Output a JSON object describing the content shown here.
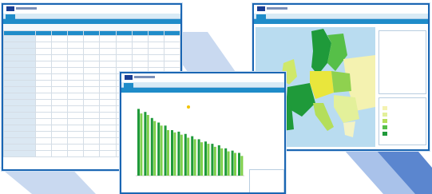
{
  "colors": {
    "frame": "#1a66b3",
    "accent": "#1f8cc9",
    "stripe_light": "#c9d9f0",
    "stripe_dark": "#5b86cf",
    "bar_dark": "#1f9a3a",
    "bar_light": "#7fd04b",
    "map_sea": "#b9dcf0"
  },
  "screens": [
    {
      "name": "table-view",
      "icon": "eu-logo-icon"
    },
    {
      "name": "chart-view",
      "icon": "eu-logo-icon"
    },
    {
      "name": "map-view",
      "icon": "eu-logo-icon"
    }
  ]
}
